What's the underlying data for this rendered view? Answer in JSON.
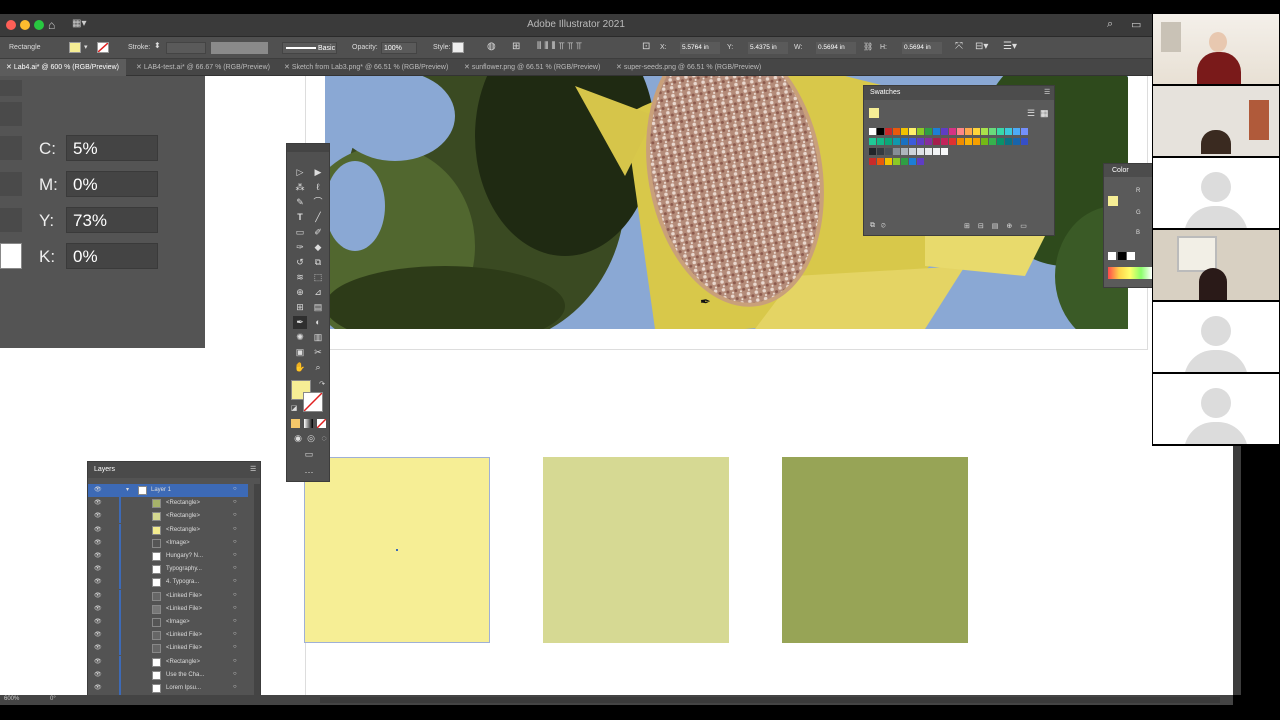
{
  "app": {
    "title": "Adobe Illustrator 2021"
  },
  "control_bar": {
    "object_type": "Rectangle",
    "stroke_label": "Stroke:",
    "brush_label": "Basic",
    "opacity_label": "Opacity:",
    "opacity_value": "100%",
    "style_label": "Style:",
    "x_label": "X:",
    "x_value": "5.5764 in",
    "y_label": "Y:",
    "y_value": "5.4375 in",
    "w_label": "W:",
    "w_value": "0.5694 in",
    "h_label": "H:",
    "h_value": "0.5694 in"
  },
  "tabs": [
    {
      "label": "Lab4.ai* @ 600 % (RGB/Preview)",
      "active": true
    },
    {
      "label": "LAB4-test.ai* @ 66.67 % (RGB/Preview)",
      "active": false
    },
    {
      "label": "Sketch from Lab3.png* @ 66.51 % (RGB/Preview)",
      "active": false
    },
    {
      "label": "sunflower.png @ 66.51 % (RGB/Preview)",
      "active": false
    },
    {
      "label": "super-seeds.png @ 66.51 % (RGB/Preview)",
      "active": false
    }
  ],
  "cmyk": [
    {
      "label": "C:",
      "value": "5%"
    },
    {
      "label": "M:",
      "value": "0%"
    },
    {
      "label": "Y:",
      "value": "73%"
    },
    {
      "label": "K:",
      "value": "0%"
    }
  ],
  "swatches_panel": {
    "title": "Swatches"
  },
  "color_panel": {
    "title": "Color",
    "channels": [
      "R",
      "G",
      "B"
    ]
  },
  "layers_panel": {
    "title": "Layers",
    "rows": [
      {
        "label": "Layer 1",
        "parent": true
      },
      {
        "label": "<Rectangle>",
        "thumb": "#a6b26a"
      },
      {
        "label": "<Rectangle>",
        "thumb": "#d4d890"
      },
      {
        "label": "<Rectangle>",
        "thumb": "#f3ec8f"
      },
      {
        "label": "<Image>",
        "thumb": "#555"
      },
      {
        "label": "Hungary? N...",
        "thumb": "#fff"
      },
      {
        "label": "Typography...",
        "thumb": "#fff"
      },
      {
        "label": "4. Typogra...",
        "thumb": "#fff"
      },
      {
        "label": "<Linked File>",
        "thumb": "#666"
      },
      {
        "label": "<Linked File>",
        "thumb": "#777"
      },
      {
        "label": "<Image>",
        "thumb": "#555"
      },
      {
        "label": "<Linked File>",
        "thumb": "#666"
      },
      {
        "label": "<Linked File>",
        "thumb": "#666"
      },
      {
        "label": "<Rectangle>",
        "thumb": "#fff"
      },
      {
        "label": "Use the Cha...",
        "thumb": "#fff"
      },
      {
        "label": "Lorem Ipsu...",
        "thumb": "#fff"
      },
      {
        "label": "<Linked File>",
        "thumb": "#666"
      }
    ]
  },
  "status_bar": {
    "zoom": "600%",
    "rotation": "0°"
  },
  "artboard_squares": [
    {
      "color": "#f6ee95",
      "selected": true
    },
    {
      "color": "#d6d993",
      "selected": false
    },
    {
      "color": "#97a456",
      "selected": false
    }
  ],
  "colors": {
    "fill_swatch": "#f6ee95",
    "ui_dark": "#3a3a3a",
    "ui_panel": "#535353",
    "accent_selection": "#3d6ab6"
  },
  "zoom_participants": [
    "video-feed",
    "video-feed",
    "avatar",
    "video-feed",
    "avatar",
    "avatar"
  ]
}
